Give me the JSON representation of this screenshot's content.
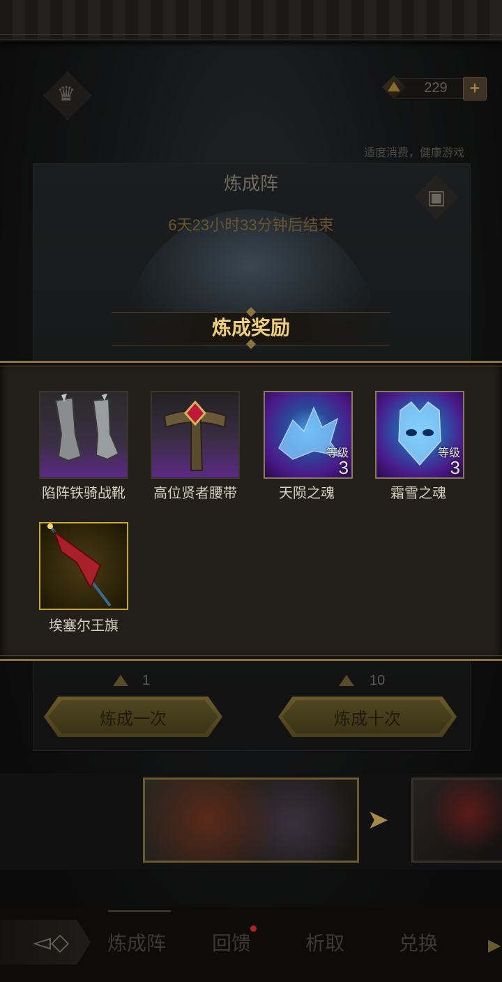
{
  "header": {
    "currency_value": "229",
    "currency_plus": "+",
    "notice": "适度消费，健康游戏",
    "crown_icon": "crown-icon"
  },
  "panel": {
    "title": "炼成阵",
    "timer": "6天23小时33分钟后结束",
    "chest_icon": "treasure-chest-icon"
  },
  "rewards": {
    "title": "炼成奖励",
    "level_label": "等级",
    "items": [
      {
        "name": "陷阵铁骑战靴",
        "rarity": "purple",
        "level": ""
      },
      {
        "name": "高位贤者腰带",
        "rarity": "purple",
        "level": ""
      },
      {
        "name": "天陨之魂",
        "rarity": "purple",
        "level": "3"
      },
      {
        "name": "霜雪之魂",
        "rarity": "purple",
        "level": "3"
      },
      {
        "name": "埃塞尔王旗",
        "rarity": "gold",
        "level": ""
      }
    ]
  },
  "actions": {
    "once_cost": "1",
    "once_label": "炼成一次",
    "ten_cost": "10",
    "ten_label": "炼成十次"
  },
  "carousel": {
    "next_icon": "chevron-right-icon"
  },
  "nav": {
    "tabs": [
      "炼成阵",
      "回馈",
      "析取",
      "兑换"
    ],
    "back_icon": "back-arrow-icon"
  },
  "colors": {
    "accent_gold": "#efcf7c",
    "purple_rarity": "#6c2a9a",
    "gold_rarity": "#b89a2a",
    "notification_red": "#b51f24"
  }
}
